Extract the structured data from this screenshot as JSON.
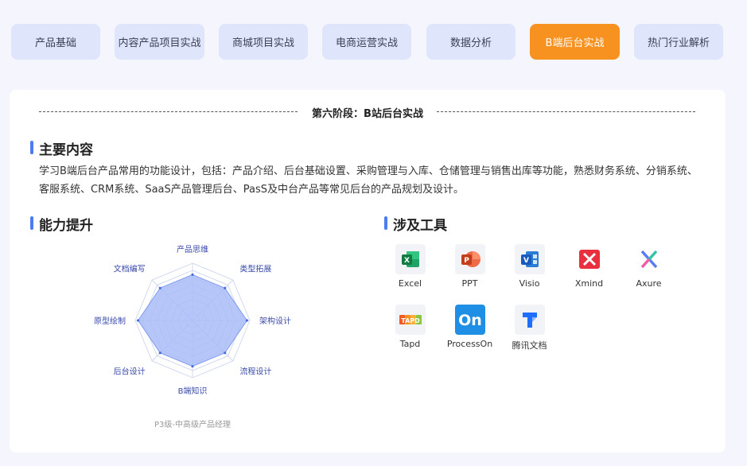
{
  "tabs": [
    {
      "label": "产品基础"
    },
    {
      "label": "内容产品项目实战"
    },
    {
      "label": "商城项目实战"
    },
    {
      "label": "电商运营实战"
    },
    {
      "label": "数据分析"
    },
    {
      "label": "B端后台实战",
      "active": true
    },
    {
      "label": "热门行业解析"
    }
  ],
  "stage": {
    "title": "第六阶段：B站后台实战"
  },
  "main_content": {
    "title": "主要内容",
    "text": "学习B端后台产品常用的功能设计，包括：产品介绍、后台基础设置、采购管理与入库、仓储管理与销售出库等功能，熟悉财务系统、分销系统、客服系统、CRM系统、SaaS产品管理后台、PasS及中台产品等常见后台的产品规划及设计。"
  },
  "ability": {
    "title": "能力提升",
    "axes": [
      "产品思维",
      "类型拓展",
      "架构设计",
      "流程设计",
      "B端知识",
      "后台设计",
      "原型绘制",
      "文档编写"
    ],
    "values": [
      0.8,
      0.8,
      0.95,
      0.8,
      0.8,
      0.8,
      0.95,
      0.8
    ],
    "caption": "P3级-中高级产品经理",
    "fill_color": "#a9bcf7",
    "grid_color": "#c8d2ee"
  },
  "tools": {
    "title": "涉及工具",
    "items": [
      {
        "name": "Excel",
        "icon": "excel-icon"
      },
      {
        "name": "PPT",
        "icon": "ppt-icon"
      },
      {
        "name": "Visio",
        "icon": "visio-icon"
      },
      {
        "name": "Xmind",
        "icon": "xmind-icon"
      },
      {
        "name": "Axure",
        "icon": "axure-icon"
      },
      {
        "name": "Tapd",
        "icon": "tapd-icon"
      },
      {
        "name": "ProcessOn",
        "icon": "processon-icon"
      },
      {
        "name": "腾讯文档",
        "icon": "tencent-docs-icon"
      }
    ]
  },
  "colors": {
    "accent": "#4c7cf1",
    "active_tab": "#f7911f",
    "tab_bg": "#dfe6fb"
  }
}
